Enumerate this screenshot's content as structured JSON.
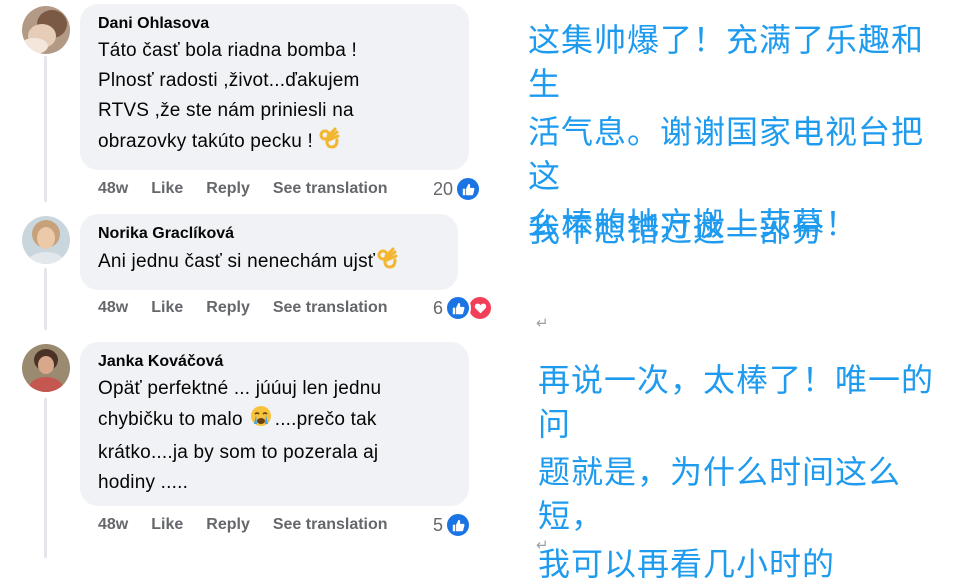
{
  "comments": [
    {
      "author": "Dani Ohlasova",
      "lines": [
        "Táto časť bola riadna bomba !",
        "Plnosť radosti ,život...ďakujem",
        "RTVS ,že ste nám priniesli na",
        "obrazovky takúto pecku !"
      ],
      "emoji": "ok-hand",
      "age": "48w",
      "like": "Like",
      "reply": "Reply",
      "translate": "See translation",
      "reaction_count": "20",
      "reactions": [
        "like"
      ]
    },
    {
      "author": "Norika Graclíková",
      "lines": [
        "Ani jednu časť si nenechám ujsť"
      ],
      "emoji": "ok-hand",
      "age": "48w",
      "like": "Like",
      "reply": "Reply",
      "translate": "See translation",
      "reaction_count": "6",
      "reactions": [
        "like",
        "love"
      ]
    },
    {
      "author": "Janka Kováčová",
      "lines": [
        "Opäť perfektné ... júúuj len jednu",
        "chybičku to malo",
        "....prečo tak",
        "krátko....ja by som to pozerala aj",
        "hodiny ....."
      ],
      "emoji": "crying-face",
      "age": "48w",
      "like": "Like",
      "reply": "Reply",
      "translate": "See translation",
      "reaction_count": "5",
      "reactions": [
        "like"
      ]
    }
  ],
  "translations": [
    {
      "lines": [
        "这集帅爆了！充满了乐趣和生",
        "活气息。谢谢国家电视台把这",
        "么棒的地方搬上荧幕！"
      ]
    },
    {
      "lines": [
        "我不想错过这一部分"
      ]
    },
    {
      "lines": [
        "再说一次，太棒了！唯一的问",
        "题就是，为什么时间这么短，",
        "我可以再看几小时的"
      ]
    }
  ],
  "return_mark": "↵",
  "colors": {
    "translation_text": "#1e9bef",
    "like_blue": "#1b74e4",
    "love_red": "#f33e58",
    "bubble": "#f0f2f5",
    "meta_gray": "#65676b"
  }
}
